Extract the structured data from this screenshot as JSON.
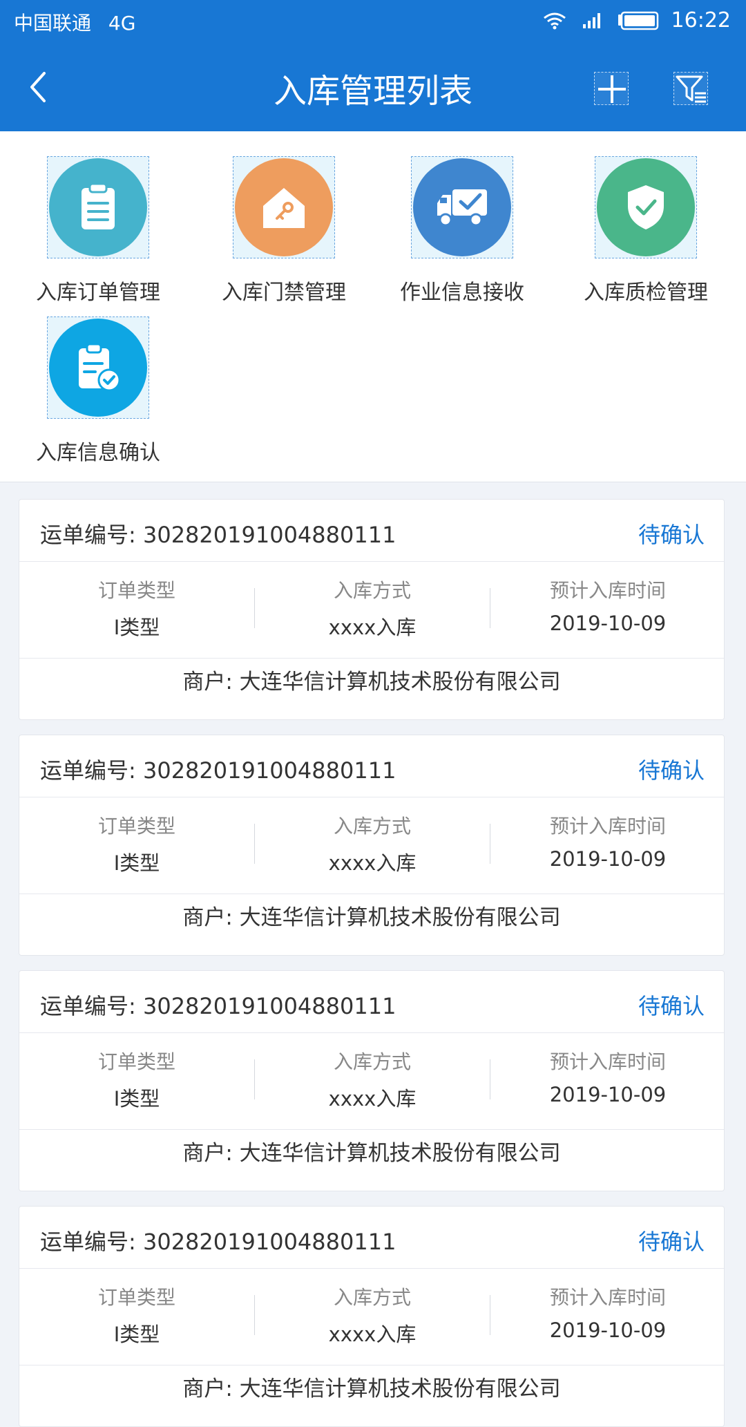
{
  "status_bar": {
    "carrier": "中国联通",
    "network": "4G",
    "time": "16:22"
  },
  "nav": {
    "title": "入库管理列表",
    "back_icon": "back-chevron-icon",
    "add_icon": "plus-icon",
    "filter_icon": "filter-icon"
  },
  "modules": [
    {
      "label": "入库订单管理",
      "icon": "clipboard-icon",
      "color": "#45b3cc"
    },
    {
      "label": "入库门禁管理",
      "icon": "house-key-icon",
      "color": "#ee9d5e"
    },
    {
      "label": "作业信息接收",
      "icon": "truck-check-icon",
      "color": "#3f86cf"
    },
    {
      "label": "入库质检管理",
      "icon": "shield-check-icon",
      "color": "#4ab68a"
    },
    {
      "label": "入库信息确认",
      "icon": "clipboard-check-icon",
      "color": "#0ea6e3"
    }
  ],
  "labels": {
    "waybill_prefix": "运单编号:",
    "col1": "订单类型",
    "col2": "入库方式",
    "col3": "预计入库时间",
    "merchant_prefix": "商户:"
  },
  "orders": [
    {
      "waybill": "302820191004880111",
      "status": "待确认",
      "type": "I类型",
      "method": "xxxx入库",
      "date": "2019-10-09",
      "merchant": "大连华信计算机技术股份有限公司"
    },
    {
      "waybill": "302820191004880111",
      "status": "待确认",
      "type": "I类型",
      "method": "xxxx入库",
      "date": "2019-10-09",
      "merchant": "大连华信计算机技术股份有限公司"
    },
    {
      "waybill": "302820191004880111",
      "status": "待确认",
      "type": "I类型",
      "method": "xxxx入库",
      "date": "2019-10-09",
      "merchant": "大连华信计算机技术股份有限公司"
    },
    {
      "waybill": "302820191004880111",
      "status": "待确认",
      "type": "I类型",
      "method": "xxxx入库",
      "date": "2019-10-09",
      "merchant": "大连华信计算机技术股份有限公司"
    }
  ],
  "colors": {
    "primary": "#1877d4",
    "background": "#f0f3f8"
  }
}
